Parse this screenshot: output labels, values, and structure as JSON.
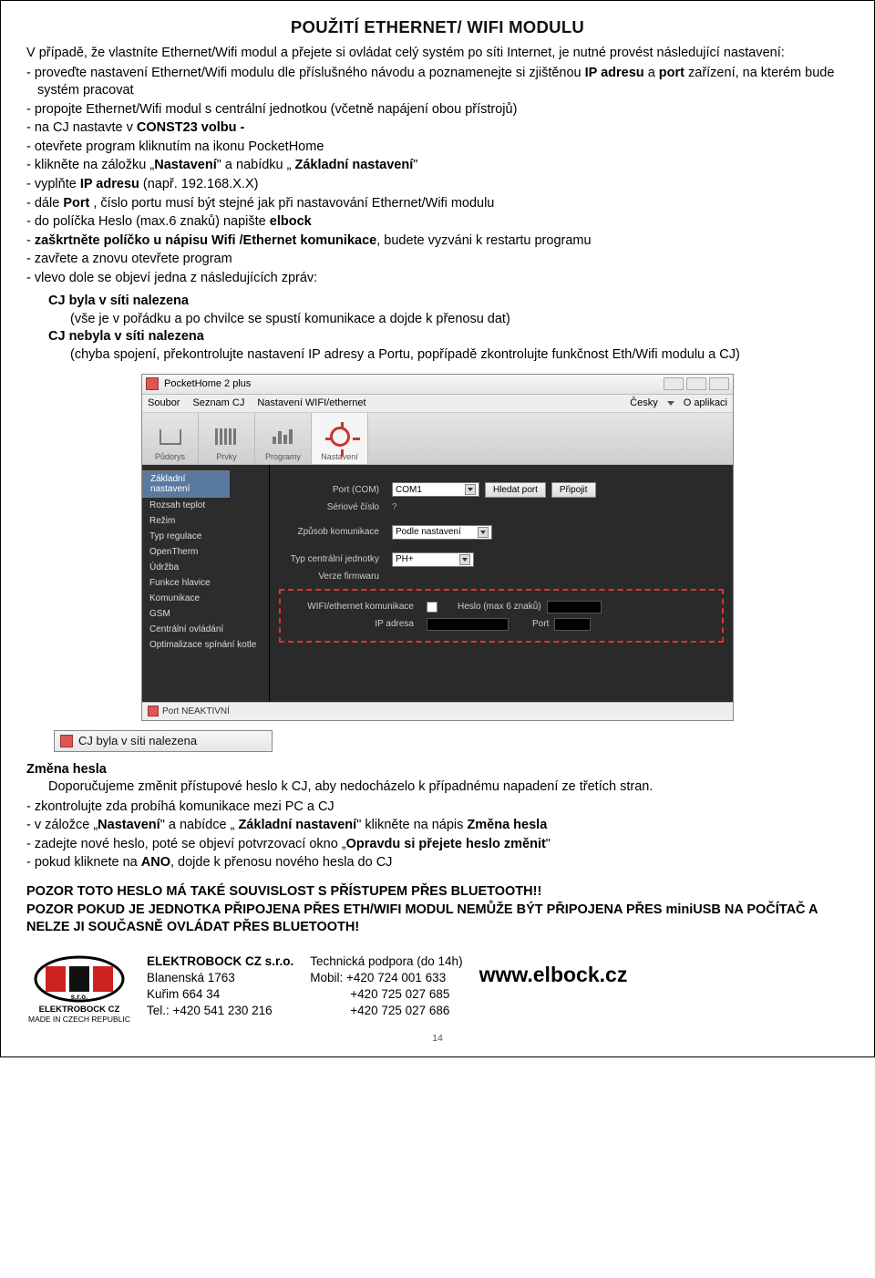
{
  "title": "POUŽITÍ ETHERNET/ WIFI MODULU",
  "intro": "V případě, že vlastníte Ethernet/Wifi modul a přejete si ovládat celý systém po síti Internet, je nutné provést následující nastavení:",
  "steps": [
    "proveďte nastavení Ethernet/Wifi modulu dle příslušného návodu a poznamenejte si zjištěnou IP adresu a port zařízení, na kterém bude systém pracovat",
    "propojte Ethernet/Wifi modul s centrální jednotkou (včetně napájení obou přístrojů)",
    "na CJ nastavte v CONST23 volbu -",
    "otevřete program kliknutím na ikonu PocketHome",
    "klikněte na záložku „Nastavení\" a nabídku „ Základní nastavení\"",
    "vyplňte IP adresu (např. 192.168.X.X)",
    "dále Port , číslo portu musí být stejné jak při nastavování Ethernet/Wifi modulu",
    "do políčka Heslo (max.6 znaků) napište elbock",
    "zaškrtněte políčko u nápisu Wifi /Ethernet komunikace, budete vyzváni k restartu programu",
    "zavřete a znovu otevřete program",
    "vlevo dole se objeví jedna z následujících zpráv:"
  ],
  "msg1": {
    "head": "CJ byla v síti nalezena",
    "body": "(vše je v pořádku a po chvilce se spustí komunikace a dojde k přenosu dat)"
  },
  "msg2": {
    "head": "CJ nebyla v síti nalezena",
    "body": "(chyba spojení, překontrolujte nastavení IP adresy a Portu, popřípadě zkontrolujte funkčnost Eth/Wifi modulu a CJ)"
  },
  "app": {
    "titlebar": "PocketHome 2 plus",
    "menu": {
      "soubor": "Soubor",
      "seznam": "Seznam CJ",
      "nast": "Nastavení WIFI/ethernet",
      "cesky": "Česky",
      "oapp": "O aplikaci"
    },
    "tabs": {
      "pudorys": "Půdorys",
      "prvky": "Prvky",
      "programy": "Programy",
      "nastaveni": "Nastavení"
    },
    "sidebar": [
      "Základní nastavení",
      "Rozsah teplot",
      "Režim",
      "Typ regulace",
      "OpenTherm",
      "Údržba",
      "Funkce hlavice",
      "Komunikace",
      "GSM",
      "Centrální ovládání",
      "Optimalizace spínání kotle"
    ],
    "form": {
      "port_lab": "Port (COM)",
      "port_val": "COM1",
      "btn_hledat": "Hledat port",
      "btn_pripojit": "Připojit",
      "seriove_lab": "Sériové číslo",
      "seriove_val": "?",
      "zpusob_lab": "Způsob komunikace",
      "zpusob_val": "Podle nastavení",
      "typ_lab": "Typ centrální jednotky",
      "typ_val": "PH+",
      "verze_lab": "Verze firmwaru",
      "wifi_lab": "WIFI/ethernet komunikace",
      "heslo_lab": "Heslo (max 6 znaků)",
      "ip_lab": "IP adresa",
      "port2_lab": "Port"
    },
    "status": "Port NEAKTIVNÍ"
  },
  "mini_status": "CJ  byla v síti nalezena",
  "change": {
    "head": "Změna hesla",
    "intro": "Doporučujeme změnit přístupové heslo k CJ, aby nedocházelo k případnému napadení ze třetích stran.",
    "items": [
      "zkontrolujte zda probíhá komunikace mezi PC a CJ",
      "v záložce „Nastavení\" a nabídce „ Základní nastavení\" klikněte na nápis Změna hesla",
      "zadejte nové heslo, poté se objeví potvrzovací okno „Opravdu si přejete heslo změnit\"",
      "pokud kliknete na ANO, dojde k přenosu nového hesla do CJ"
    ]
  },
  "warn1": "POZOR TOTO HESLO MÁ TAKÉ SOUVISLOST S PŘÍSTUPEM PŘES BLUETOOTH!!",
  "warn2": "POZOR POKUD JE JEDNOTKA PŘIPOJENA PŘES ETH/WIFI MODUL NEMŮŽE BÝT PŘIPOJENA PŘES miniUSB NA POČÍTAČ A NELZE JI SOUČASNĚ OVLÁDAT PŘES BLUETOOTH!",
  "footer": {
    "brand": "ELEKTROBOCK CZ",
    "made": "MADE IN CZECH REPUBLIC",
    "company": "ELEKTROBOCK CZ s.r.o.",
    "addr1": "Blanenská 1763",
    "addr2": "Kuřim 664 34",
    "tel": "Tel.: +420 541 230 216",
    "sup_head": "Technická podpora (do 14h)",
    "mob": "Mobil: +420 724 001 633",
    "p1": "+420 725 027 685",
    "p2": "+420 725 027 686",
    "url": "www.elbock.cz"
  },
  "pageno": "14"
}
